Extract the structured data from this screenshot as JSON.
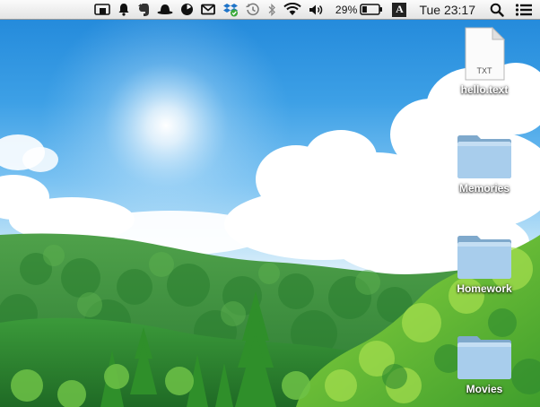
{
  "menubar": {
    "status_icons": [
      "airplay-mirroring-icon",
      "notification-bell-icon",
      "evernote-elephant-icon",
      "bowler-hat-icon",
      "pie-timer-icon",
      "mail-envelope-icon",
      "dropbox-icon",
      "time-machine-icon",
      "bluetooth-icon",
      "wifi-icon",
      "volume-icon"
    ],
    "battery_percent": "29%",
    "input_source_label": "A",
    "clock": "Tue 23:17",
    "spotlight_icon": "search-icon",
    "notification_center_icon": "list-icon"
  },
  "desktop": {
    "items": [
      {
        "label": "hello.text",
        "type": "text-file",
        "file_tag": "TXT"
      },
      {
        "label": "Memories",
        "type": "folder"
      },
      {
        "label": "Homework",
        "type": "folder"
      },
      {
        "label": "Movies",
        "type": "folder"
      }
    ]
  },
  "colors": {
    "sky_top": "#1f86d9",
    "folder_blue": "#9ec6e6",
    "forest_green": "#2f8a2f"
  }
}
